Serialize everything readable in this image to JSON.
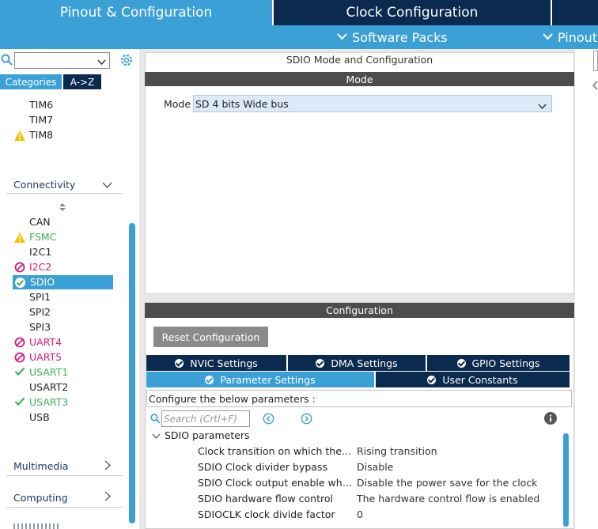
{
  "tabs": {
    "pinout": "Pinout & Configuration",
    "clock": "Clock Configuration"
  },
  "subbar": {
    "software_packs": "Software Packs",
    "pinout": "Pinout"
  },
  "left": {
    "search_value": "",
    "categories_tab": "Categories",
    "az_tab": "A->Z",
    "timers": [
      "TIM6",
      "TIM7",
      "TIM8"
    ],
    "connectivity_label": "Connectivity",
    "connectivity_items": [
      "CAN",
      "FSMC",
      "I2C1",
      "I2C2",
      "SDIO",
      "SPI1",
      "SPI2",
      "SPI3",
      "UART4",
      "UART5",
      "USART1",
      "USART2",
      "USART3",
      "USB"
    ],
    "multimedia_label": "Multimedia",
    "computing_label": "Computing"
  },
  "mode_panel": {
    "title": "SDIO Mode and Configuration",
    "mode_header": "Mode",
    "mode_label": "Mode",
    "mode_value": "SD 4 bits Wide bus"
  },
  "config_panel": {
    "header": "Configuration",
    "reset_button": "Reset Configuration",
    "tabs": {
      "nvic": "NVIC Settings",
      "dma": "DMA Settings",
      "gpio": "GPIO Settings",
      "parameter": "Parameter Settings",
      "user_constants": "User Constants"
    },
    "instruction": "Configure the below parameters :",
    "search_placeholder": "Search (Crtl+F)",
    "group_label": "SDIO parameters",
    "params": [
      {
        "name": "Clock transition on which the bit...",
        "value": "Rising transition"
      },
      {
        "name": "SDIO Clock divider bypass",
        "value": "Disable"
      },
      {
        "name": "SDIO Clock output enable when...",
        "value": "Disable the power save for the clock"
      },
      {
        "name": "SDIO hardware flow control",
        "value": "The hardware control flow is enabled"
      },
      {
        "name": "SDIOCLK clock divide factor",
        "value": "0"
      }
    ]
  },
  "colors": {
    "accent_blue": "#3ba0d6",
    "dark_navy": "#0b2a4f",
    "warning_yellow": "#f2c200",
    "error_magenta": "#d6157a",
    "ok_green": "#3fae5a"
  }
}
